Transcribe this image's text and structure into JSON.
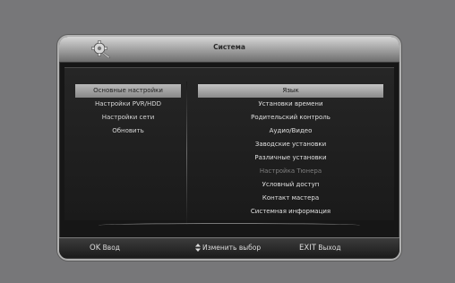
{
  "window": {
    "title": "Система"
  },
  "left_menu": {
    "items": [
      {
        "label": "Основные настройки",
        "active": true
      },
      {
        "label": "Настройки PVR/HDD",
        "active": false
      },
      {
        "label": "Настройки сети",
        "active": false
      },
      {
        "label": "Обновить",
        "active": false
      }
    ]
  },
  "right_menu": {
    "items": [
      {
        "label": "Язык",
        "selected": true
      },
      {
        "label": "Установки времени"
      },
      {
        "label": "Родительский контроль"
      },
      {
        "label": "Аудио/Видео"
      },
      {
        "label": "Заводские установки"
      },
      {
        "label": "Различные установки"
      },
      {
        "label": "Настройка Тюнера",
        "disabled": true
      },
      {
        "label": "Условный доступ"
      },
      {
        "label": "Контакт мастера"
      },
      {
        "label": "Системная информация"
      }
    ]
  },
  "footer": {
    "ok_key": "OK",
    "ok_label": "Ввод",
    "nav_label": "Изменить выбор",
    "nav_icon": "up-down-arrows-icon",
    "exit_key": "EXIT",
    "exit_label": "Выход"
  },
  "colors": {
    "background": "#777779",
    "frame": "#161616",
    "highlight": "#b0b0b0"
  }
}
